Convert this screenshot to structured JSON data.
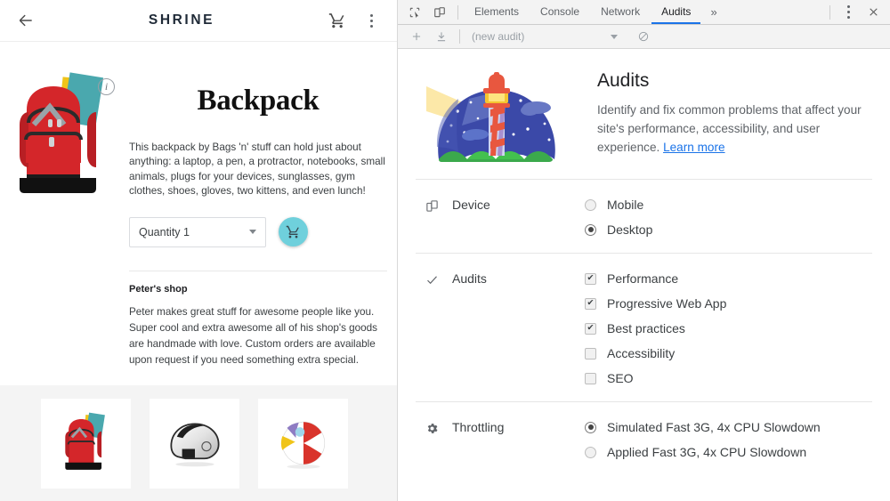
{
  "app": {
    "title": "SHRINE",
    "back_icon": "back-arrow-icon",
    "cart_icon": "shopping-cart-icon",
    "menu_icon": "overflow-menu-icon",
    "info_icon": "info-icon",
    "product": {
      "name": "Backpack",
      "description": "This backpack by Bags 'n' stuff can hold just about anything: a laptop, a pen, a protractor, notebooks, small animals, plugs for your devices, sunglasses, gym clothes, shoes, gloves, two kittens, and even lunch!",
      "quantity_label": "Quantity 1",
      "add_to_cart_icon": "add-to-cart-icon"
    },
    "shop": {
      "name": "Peter's shop",
      "description": "Peter makes great stuff for awesome people like you. Super cool and extra awesome all of his shop's goods are handmade with love. Custom orders are available upon request if you need something extra special."
    },
    "related": [
      {
        "name": "backpack-thumbnail"
      },
      {
        "name": "helmet-thumbnail"
      },
      {
        "name": "beach-ball-thumbnail"
      }
    ]
  },
  "devtools": {
    "inspect_icon": "inspect-element-icon",
    "device_toolbar_icon": "device-toolbar-icon",
    "tabs": [
      {
        "label": "Elements",
        "active": false
      },
      {
        "label": "Console",
        "active": false
      },
      {
        "label": "Network",
        "active": false
      },
      {
        "label": "Audits",
        "active": true
      }
    ],
    "more_tabs_label": "»",
    "settings_icon": "settings-menu-icon",
    "close_icon": "close-icon",
    "toolbar": {
      "add_icon": "add-icon",
      "download_icon": "download-icon",
      "audit_name": "(new audit)",
      "clear_icon": "clear-icon"
    },
    "panel": {
      "title": "Audits",
      "description_text": "Identify and fix common problems that affect your site's performance, accessibility, and user experience. ",
      "learn_more": "Learn more",
      "illustration": "lighthouse-illustration"
    },
    "sections": [
      {
        "label": "Device",
        "icon": "device-icon",
        "type": "radio",
        "options": [
          {
            "label": "Mobile",
            "selected": false
          },
          {
            "label": "Desktop",
            "selected": true
          }
        ]
      },
      {
        "label": "Audits",
        "icon": "check-icon",
        "type": "checkbox",
        "options": [
          {
            "label": "Performance",
            "checked": true
          },
          {
            "label": "Progressive Web App",
            "checked": true
          },
          {
            "label": "Best practices",
            "checked": true
          },
          {
            "label": "Accessibility",
            "checked": false
          },
          {
            "label": "SEO",
            "checked": false
          }
        ]
      },
      {
        "label": "Throttling",
        "icon": "gear-icon",
        "type": "radio",
        "options": [
          {
            "label": "Simulated Fast 3G, 4x CPU Slowdown",
            "selected": true
          },
          {
            "label": "Applied Fast 3G, 4x CPU Slowdown",
            "selected": false
          }
        ]
      }
    ],
    "colors": {
      "accent": "#1a73e8",
      "link": "#1a73e8"
    }
  }
}
